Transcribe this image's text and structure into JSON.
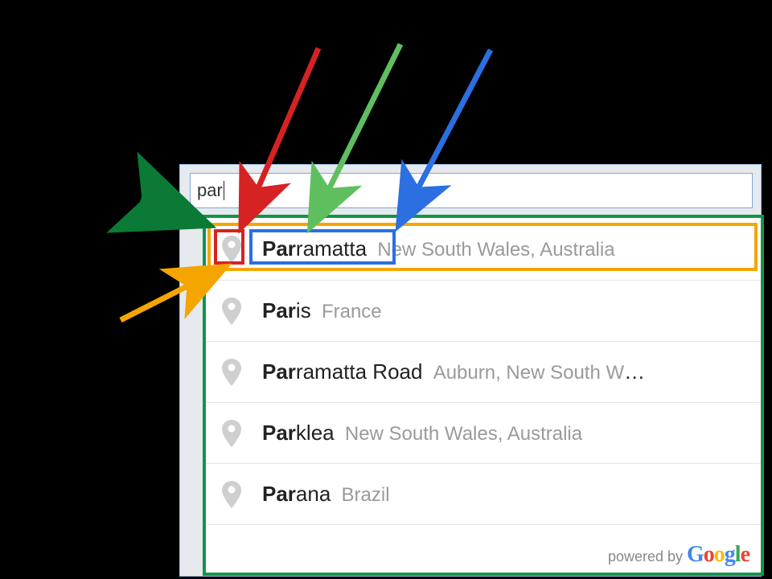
{
  "search": {
    "value": "par"
  },
  "dropdown": {
    "items": [
      {
        "match": "Par",
        "rest": "ramatta",
        "secondary": "New South Wales, Australia"
      },
      {
        "match": "Par",
        "rest": "is",
        "secondary": "France"
      },
      {
        "match": "Par",
        "rest": "ramatta Road",
        "secondary": "Auburn, New South W",
        "truncated": "…"
      },
      {
        "match": "Par",
        "rest": "klea",
        "secondary": "New South Wales, Australia"
      },
      {
        "match": "Par",
        "rest": "ana",
        "secondary": "Brazil"
      }
    ]
  },
  "footer": {
    "prefix": "powered by ",
    "logo": "Google"
  },
  "annotations": {
    "arrows": [
      "red",
      "light-green",
      "blue",
      "dark-green",
      "orange"
    ],
    "highlight_boxes": [
      "green-dropdown-container",
      "orange-row",
      "red-icon",
      "blue-main-text"
    ]
  }
}
